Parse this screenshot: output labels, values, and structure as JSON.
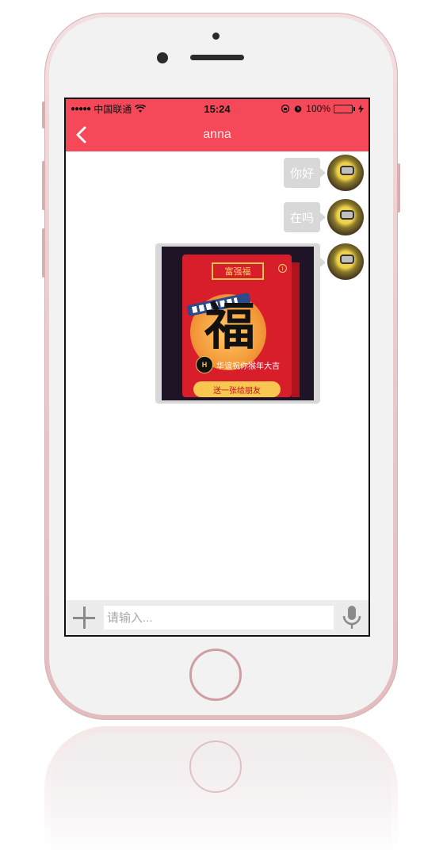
{
  "status_bar": {
    "signal": "●●●●●",
    "carrier": "中国联通",
    "time": "15:24",
    "battery": "100%"
  },
  "nav": {
    "title": "anna"
  },
  "messages": [
    {
      "text": "你好"
    },
    {
      "text": "在吗"
    }
  ],
  "card": {
    "badge": "富强福",
    "character": "福",
    "logo": "H",
    "blessing": "华谊祝你猴年大吉",
    "share_label": "送一张给朋友"
  },
  "input": {
    "placeholder": "请输入..."
  },
  "colors": {
    "nav_bg": "#f5495a",
    "bubble_bg": "#d8d8d8",
    "card_red": "#d81e2a",
    "share_button": "#f7c74f"
  },
  "icons": [
    "back-chevron-icon",
    "wifi-icon",
    "lock-rotation-icon",
    "alarm-icon",
    "battery-icon",
    "charging-icon",
    "plus-icon",
    "microphone-icon",
    "info-icon"
  ]
}
